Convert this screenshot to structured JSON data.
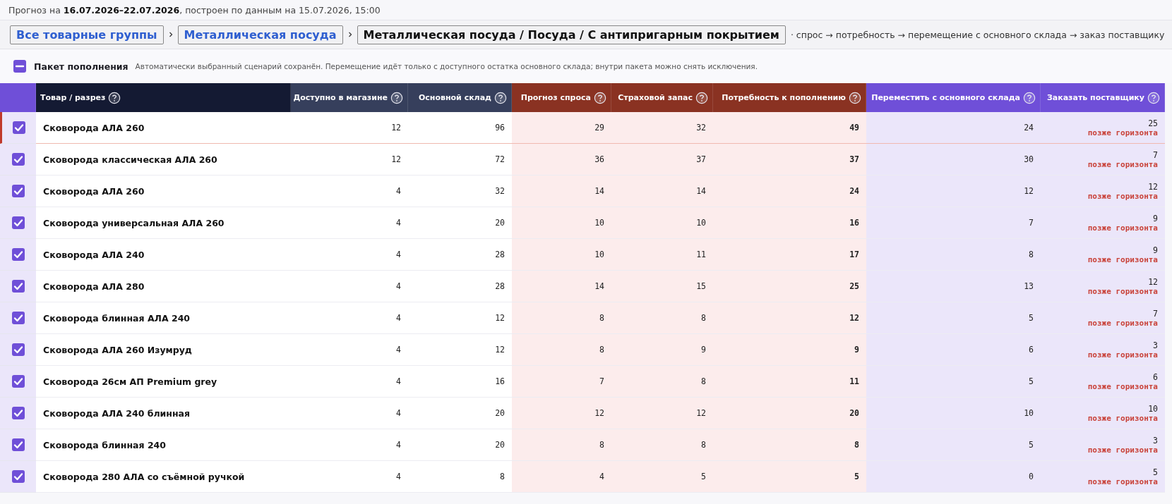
{
  "forecast_line": {
    "text": "Прогноз на **16.07.2026–22.07.2026**, построен по данным на 15.07.2026, 15:00"
  },
  "breadcrumbs": [
    {
      "label": "Все товарные группы",
      "kind": "link"
    },
    {
      "label": "Металлическая посуда",
      "kind": "link"
    },
    {
      "label": "Металлическая посуда / Посуда / С антипригарным покрытием",
      "kind": "current"
    }
  ],
  "flow_hint": "· спрос → потребность → перемещение с основного склада → заказ поставщику",
  "package": {
    "indeterminate": true,
    "title": "Пакет пополнения",
    "note": "Автоматически выбранный сценарий сохранён. Перемещение идёт только с доступного остатка основного склада; внутри пакета можно снять исключения."
  },
  "table": {
    "columns": [
      {
        "label": "Товар / разрез",
        "kind": "item"
      },
      {
        "label": "Доступно в магазине",
        "kind": "stock"
      },
      {
        "label": "Основной склад",
        "kind": "stock"
      },
      {
        "label": "Прогноз спроса",
        "kind": "demand"
      },
      {
        "label": "Страховой запас",
        "kind": "demand"
      },
      {
        "label": "Потребность к пополнению",
        "kind": "demand"
      },
      {
        "label": "Переместить с основного склада",
        "kind": "action"
      },
      {
        "label": "Заказать поставщику",
        "kind": "action"
      }
    ],
    "rows": [
      {
        "checked": true,
        "selected": true,
        "cells": [
          "Сковорода АЛА 260",
          "12",
          "96",
          "29",
          "32",
          "49",
          "24",
          "25"
        ],
        "order_note": "позже горизонта"
      },
      {
        "checked": true,
        "selected": false,
        "cells": [
          "Сковорода классическая АЛА 260",
          "12",
          "72",
          "36",
          "37",
          "37",
          "30",
          "7"
        ],
        "order_note": "позже горизонта"
      },
      {
        "checked": true,
        "selected": false,
        "cells": [
          "Сковорода АЛА 260",
          "4",
          "32",
          "14",
          "14",
          "24",
          "12",
          "12"
        ],
        "order_note": "позже горизонта"
      },
      {
        "checked": true,
        "selected": false,
        "cells": [
          "Сковорода универсальная АЛА 260",
          "4",
          "20",
          "10",
          "10",
          "16",
          "7",
          "9"
        ],
        "order_note": "позже горизонта"
      },
      {
        "checked": true,
        "selected": false,
        "cells": [
          "Сковорода АЛА 240",
          "4",
          "28",
          "10",
          "11",
          "17",
          "8",
          "9"
        ],
        "order_note": "позже горизонта"
      },
      {
        "checked": true,
        "selected": false,
        "cells": [
          "Сковорода АЛА 280",
          "4",
          "28",
          "14",
          "15",
          "25",
          "13",
          "12"
        ],
        "order_note": "позже горизонта"
      },
      {
        "checked": true,
        "selected": false,
        "cells": [
          "Сковорода блинная АЛА 240",
          "4",
          "12",
          "8",
          "8",
          "12",
          "5",
          "7"
        ],
        "order_note": "позже горизонта"
      },
      {
        "checked": true,
        "selected": false,
        "cells": [
          "Сковорода АЛА 260 Изумруд",
          "4",
          "12",
          "8",
          "9",
          "9",
          "6",
          "3"
        ],
        "order_note": "позже горизонта"
      },
      {
        "checked": true,
        "selected": false,
        "cells": [
          "Сковорода 26см АП Premium grey",
          "4",
          "16",
          "7",
          "8",
          "11",
          "5",
          "6"
        ],
        "order_note": "позже горизонта"
      },
      {
        "checked": true,
        "selected": false,
        "cells": [
          "Сковорода АЛА 240 блинная",
          "4",
          "20",
          "12",
          "12",
          "20",
          "10",
          "10"
        ],
        "order_note": "позже горизонта"
      },
      {
        "checked": true,
        "selected": false,
        "cells": [
          "Сковорода блинная 240",
          "4",
          "20",
          "8",
          "8",
          "8",
          "5",
          "3"
        ],
        "order_note": "позже горизонта"
      },
      {
        "checked": true,
        "selected": false,
        "cells": [
          "Сковорода 280 АЛА со съёмной ручкой",
          "4",
          "8",
          "4",
          "5",
          "5",
          "0",
          "5"
        ],
        "order_note": "позже горизонта"
      }
    ]
  }
}
